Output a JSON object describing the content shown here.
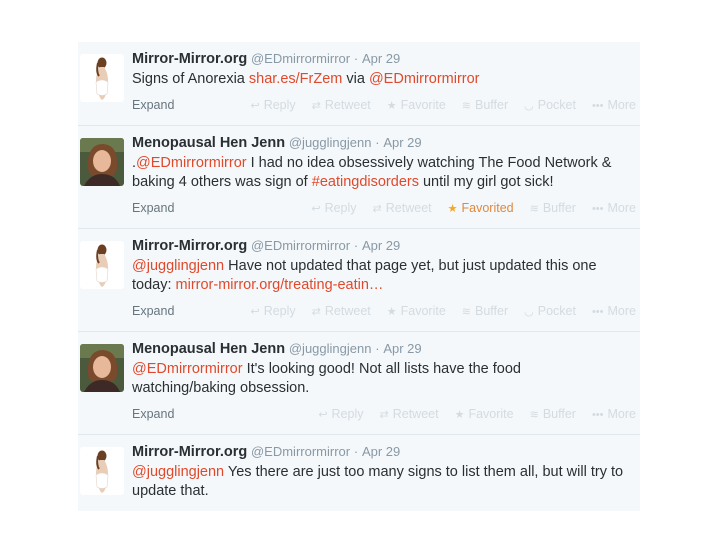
{
  "tweets": [
    {
      "name": "Mirror-Mirror.org",
      "screen": "@EDmirrormirror",
      "dot": "·",
      "date": "Apr 29",
      "avatar": "mirror",
      "text": [
        {
          "t": "Signs of Anorexia ",
          "link": false
        },
        {
          "t": "shar.es/FrZem",
          "link": true
        },
        {
          "t": "  via ",
          "link": false
        },
        {
          "t": "@EDmirrormirror",
          "link": true
        }
      ],
      "expand": "Expand",
      "actions": [
        {
          "icon": "reply-icon",
          "glyph": "↩",
          "label": "Reply"
        },
        {
          "icon": "retweet-icon",
          "glyph": "⇄",
          "label": "Retweet"
        },
        {
          "icon": "star-icon",
          "glyph": "★",
          "label": "Favorite"
        },
        {
          "icon": "buffer-icon",
          "glyph": "≋",
          "label": "Buffer"
        },
        {
          "icon": "pocket-icon",
          "glyph": "◡",
          "label": "Pocket"
        },
        {
          "icon": "more-icon",
          "glyph": "•••",
          "label": "More"
        }
      ]
    },
    {
      "name": "Menopausal Hen Jenn",
      "screen": "@jugglingjenn",
      "dot": "·",
      "date": "Apr 29",
      "avatar": "jenn",
      "text": [
        {
          "t": ".",
          "link": false
        },
        {
          "t": "@EDmirrormirror",
          "link": true
        },
        {
          "t": " I had no idea obsessively watching The Food Network & baking 4 others was sign of ",
          "link": false
        },
        {
          "t": "#eatingdisorders",
          "link": true
        },
        {
          "t": " until my girl got sick!",
          "link": false
        }
      ],
      "expand": "Expand",
      "actions": [
        {
          "icon": "reply-icon",
          "glyph": "↩",
          "label": "Reply"
        },
        {
          "icon": "retweet-icon",
          "glyph": "⇄",
          "label": "Retweet"
        },
        {
          "icon": "star-icon",
          "glyph": "★",
          "label": "Favorited",
          "active": true
        },
        {
          "icon": "buffer-icon",
          "glyph": "≋",
          "label": "Buffer"
        },
        {
          "icon": "more-icon",
          "glyph": "•••",
          "label": "More"
        }
      ]
    },
    {
      "name": "Mirror-Mirror.org",
      "screen": "@EDmirrormirror",
      "dot": "·",
      "date": "Apr 29",
      "avatar": "mirror",
      "text": [
        {
          "t": "@jugglingjenn",
          "link": true
        },
        {
          "t": " Have not updated that page yet, but just updated this one today: ",
          "link": false
        },
        {
          "t": "mirror-mirror.org/treating-eatin…",
          "link": true
        }
      ],
      "expand": "Expand",
      "actions": [
        {
          "icon": "reply-icon",
          "glyph": "↩",
          "label": "Reply"
        },
        {
          "icon": "retweet-icon",
          "glyph": "⇄",
          "label": "Retweet"
        },
        {
          "icon": "star-icon",
          "glyph": "★",
          "label": "Favorite"
        },
        {
          "icon": "buffer-icon",
          "glyph": "≋",
          "label": "Buffer"
        },
        {
          "icon": "pocket-icon",
          "glyph": "◡",
          "label": "Pocket"
        },
        {
          "icon": "more-icon",
          "glyph": "•••",
          "label": "More"
        }
      ]
    },
    {
      "name": "Menopausal Hen Jenn",
      "screen": "@jugglingjenn",
      "dot": "·",
      "date": "Apr 29",
      "avatar": "jenn",
      "text": [
        {
          "t": "@EDmirrormirror",
          "link": true
        },
        {
          "t": " It's looking good! Not all lists have the food watching/baking obsession.",
          "link": false
        }
      ],
      "expand": "Expand",
      "actions": [
        {
          "icon": "reply-icon",
          "glyph": "↩",
          "label": "Reply"
        },
        {
          "icon": "retweet-icon",
          "glyph": "⇄",
          "label": "Retweet"
        },
        {
          "icon": "star-icon",
          "glyph": "★",
          "label": "Favorite"
        },
        {
          "icon": "buffer-icon",
          "glyph": "≋",
          "label": "Buffer"
        },
        {
          "icon": "more-icon",
          "glyph": "•••",
          "label": "More"
        }
      ]
    },
    {
      "name": "Mirror-Mirror.org",
      "screen": "@EDmirrormirror",
      "dot": "·",
      "date": "Apr 29",
      "avatar": "mirror",
      "text": [
        {
          "t": "@jugglingjenn",
          "link": true
        },
        {
          "t": " Yes there are just too many signs to list them all, but will try to update that.",
          "link": false
        }
      ],
      "expand": "",
      "actions": []
    }
  ],
  "colors": {
    "link": "#e0492b",
    "name": "#292f33",
    "meta": "#8899a6",
    "action_inactive": "#d3dbe1",
    "favorited": "#e0883e",
    "background": "#f5f8fa"
  }
}
